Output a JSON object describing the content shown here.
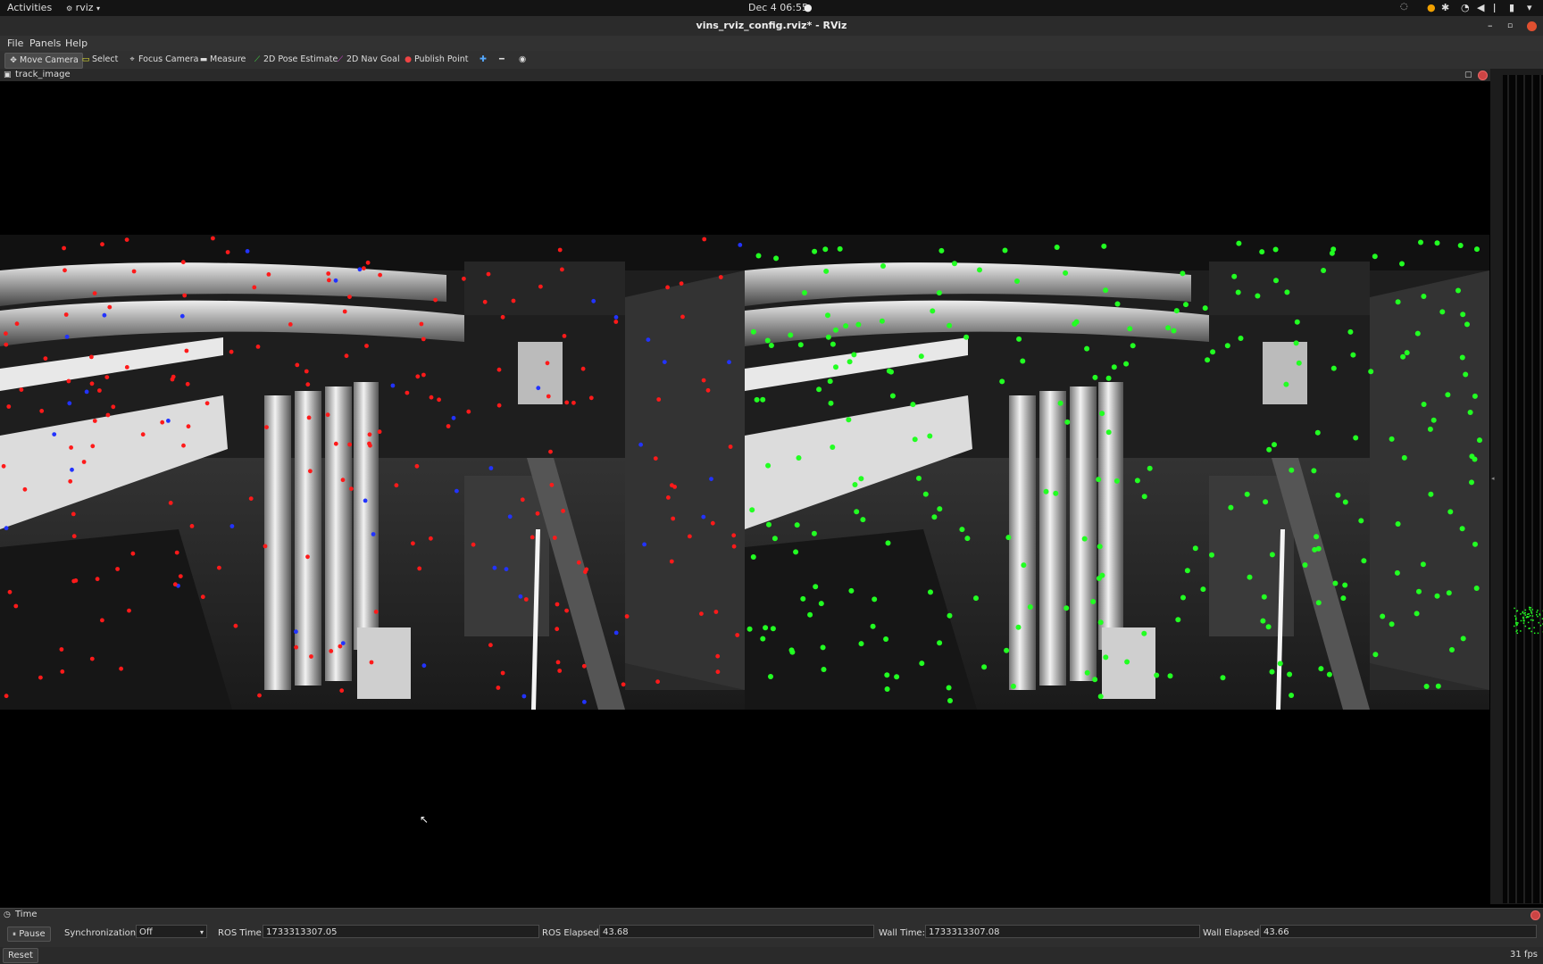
{
  "system": {
    "activities": "Activities",
    "app_name": "rviz",
    "clock": "Dec 4  06:55"
  },
  "window": {
    "title": "vins_rviz_config.rviz* - RViz"
  },
  "menu": {
    "file": "File",
    "panels": "Panels",
    "help": "Help"
  },
  "toolbar": {
    "move_camera": "Move Camera",
    "select": "Select",
    "focus_camera": "Focus Camera",
    "measure": "Measure",
    "pose_estimate": "2D Pose Estimate",
    "nav_goal": "2D Nav Goal",
    "publish_point": "Publish Point"
  },
  "image_panel": {
    "title": "track_image"
  },
  "time_panel": {
    "title": "Time",
    "pause_label": "Pause",
    "sync_label": "Synchronization:",
    "sync_value": "Off",
    "ros_time_label": "ROS Time:",
    "ros_time_value": "1733313307.05",
    "ros_elapsed_label": "ROS Elapsed:",
    "ros_elapsed_value": "43.68",
    "wall_time_label": "Wall Time:",
    "wall_time_value": "1733313307.08",
    "wall_elapsed_label": "Wall Elapsed:",
    "wall_elapsed_value": "43.66"
  },
  "status": {
    "reset_label": "Reset",
    "fps": "31 fps"
  },
  "colors": {
    "left_features": "#ff1a1a",
    "left_features_alt": "#2233ff",
    "right_features": "#22ff22"
  }
}
